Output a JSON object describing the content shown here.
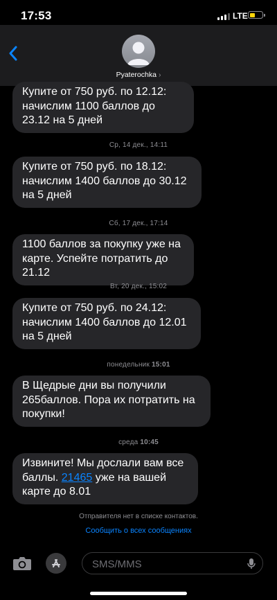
{
  "status": {
    "time": "17:53",
    "network": "LTE"
  },
  "header": {
    "contact_name": "Pyaterochka",
    "chevron": "›"
  },
  "messages": [
    {
      "text": "Купите от 750 руб. по 12.12: начислим 1100 баллов до 23.12 на 5 дней"
    },
    {
      "timestamp_day": "Ср, 14 дек.,",
      "timestamp_time": "14:11",
      "text": "Купите от 750 руб. по 18.12: начислим 1400 баллов до 30.12 на 5 дней"
    },
    {
      "timestamp_day": "Сб, 17 дек.,",
      "timestamp_time": "17:14",
      "text": "1100 баллов за покупку уже на карте. Успейте потратить до 21.12"
    },
    {
      "timestamp_day": "Вт, 20 дек.,",
      "timestamp_time": "15:02",
      "text": "Купите от 750 руб. по 24.12: начислим 1400 баллов до 12.01 на 5 дней"
    },
    {
      "timestamp_day": "понедельник",
      "timestamp_time": "15:01",
      "text": "В Щедрые дни вы получили 265баллов. Пора их потратить на покупки!"
    },
    {
      "timestamp_day": "среда",
      "timestamp_time": "10:45",
      "text_before": "Извините! Мы дослали вам все баллы. ",
      "link": "21465",
      "text_after": " уже на вашей карте до 8.01"
    }
  ],
  "footer": {
    "notice": "Отправителя нет в списке контактов.",
    "report_link": "Сообщить о всех сообщениях"
  },
  "input": {
    "placeholder": "SMS/MMS"
  },
  "icons": {
    "back": "chevron-left-icon",
    "camera": "camera-icon",
    "apps": "app-store-icon",
    "mic": "microphone-icon",
    "signal": "cellular-signal-icon",
    "battery": "battery-icon"
  },
  "colors": {
    "accent": "#0a84ff",
    "bubble": "#262629",
    "battery": "#ffd60a",
    "header_bg": "#1c1c1e"
  }
}
